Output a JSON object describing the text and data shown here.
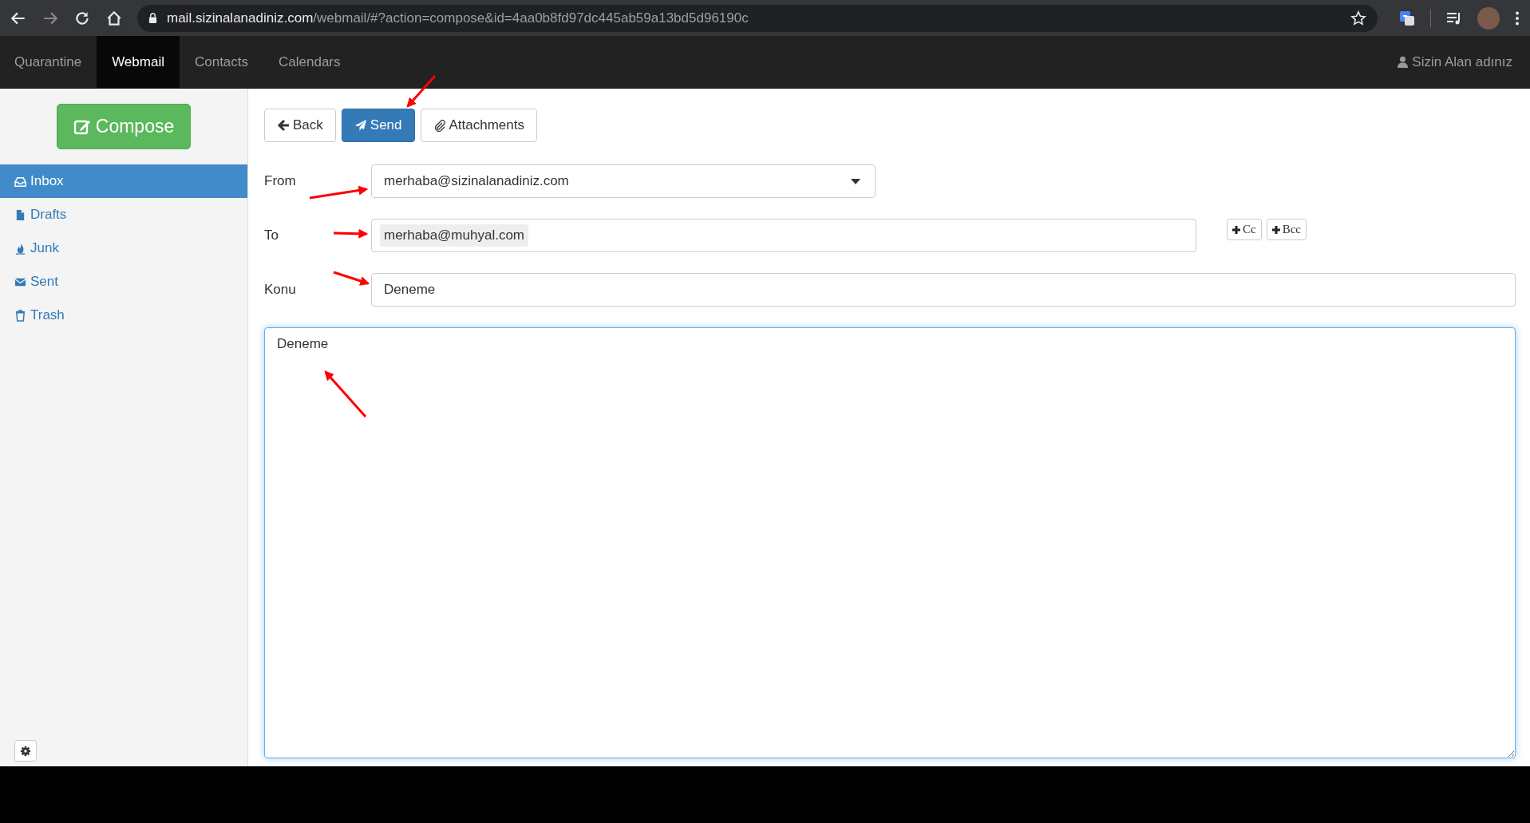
{
  "browser": {
    "url_host": "mail.sizinalanadiniz.com",
    "url_path": "/webmail/#?action=compose&id=4aa0b8fd97dc445ab59a13bd5d96190c"
  },
  "navbar": {
    "items": [
      {
        "label": "Quarantine",
        "selected": false
      },
      {
        "label": "Webmail",
        "selected": true
      },
      {
        "label": "Contacts",
        "selected": false
      },
      {
        "label": "Calendars",
        "selected": false
      }
    ],
    "user": "Sizin Alan adınız"
  },
  "sidebar": {
    "compose": "Compose",
    "folders": [
      {
        "label": "Inbox",
        "selected": true
      },
      {
        "label": "Drafts",
        "selected": false
      },
      {
        "label": "Junk",
        "selected": false
      },
      {
        "label": "Sent",
        "selected": false
      },
      {
        "label": "Trash",
        "selected": false
      }
    ]
  },
  "toolbar": [
    {
      "label": "Back",
      "kind": "back"
    },
    {
      "label": "Send",
      "kind": "send"
    },
    {
      "label": "Attachments",
      "kind": "attach"
    }
  ],
  "form": {
    "from": {
      "label": "From",
      "value": "merhaba@sizinalanadiniz.com"
    },
    "to": {
      "label": "To",
      "value": "merhaba@muhyal.com"
    },
    "extra_buttons": [
      "Cc",
      "Bcc"
    ],
    "subject": {
      "label": "Konu",
      "value": "Deneme"
    },
    "body": "Deneme"
  }
}
